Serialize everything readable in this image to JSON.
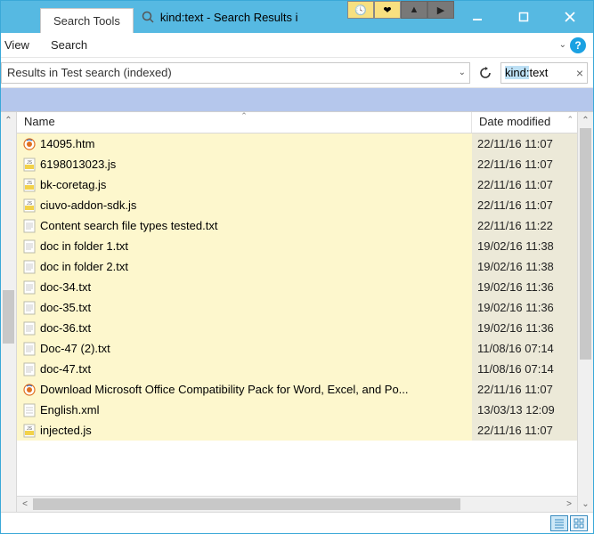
{
  "titlebar": {
    "tab_label": "Search Tools",
    "title": "kind:text - Search Results i"
  },
  "menubar": {
    "view": "View",
    "search": "Search"
  },
  "addressbar": {
    "path": "Results in Test search (indexed)"
  },
  "searchbox": {
    "kind_label": "kind:",
    "query": "text"
  },
  "columns": {
    "name": "Name",
    "date": "Date modified"
  },
  "files": [
    {
      "name": "14095.htm",
      "date": "22/11/16 11:07",
      "type": "htm"
    },
    {
      "name": "6198013023.js",
      "date": "22/11/16 11:07",
      "type": "js"
    },
    {
      "name": "bk-coretag.js",
      "date": "22/11/16 11:07",
      "type": "js"
    },
    {
      "name": "ciuvo-addon-sdk.js",
      "date": "22/11/16 11:07",
      "type": "js"
    },
    {
      "name": "Content search file types tested.txt",
      "date": "22/11/16 11:22",
      "type": "txt"
    },
    {
      "name": "doc in folder 1.txt",
      "date": "19/02/16 11:38",
      "type": "txt"
    },
    {
      "name": "doc in folder 2.txt",
      "date": "19/02/16 11:38",
      "type": "txt"
    },
    {
      "name": "doc-34.txt",
      "date": "19/02/16 11:36",
      "type": "txt"
    },
    {
      "name": "doc-35.txt",
      "date": "19/02/16 11:36",
      "type": "txt"
    },
    {
      "name": "doc-36.txt",
      "date": "19/02/16 11:36",
      "type": "txt"
    },
    {
      "name": "Doc-47 (2).txt",
      "date": "11/08/16 07:14",
      "type": "txt"
    },
    {
      "name": "doc-47.txt",
      "date": "11/08/16 07:14",
      "type": "txt"
    },
    {
      "name": "Download Microsoft Office Compatibility Pack for Word, Excel, and Po...",
      "date": "22/11/16 11:07",
      "type": "htm"
    },
    {
      "name": "English.xml",
      "date": "13/03/13 12:09",
      "type": "xml"
    },
    {
      "name": "injected.js",
      "date": "22/11/16 11:07",
      "type": "js"
    }
  ]
}
